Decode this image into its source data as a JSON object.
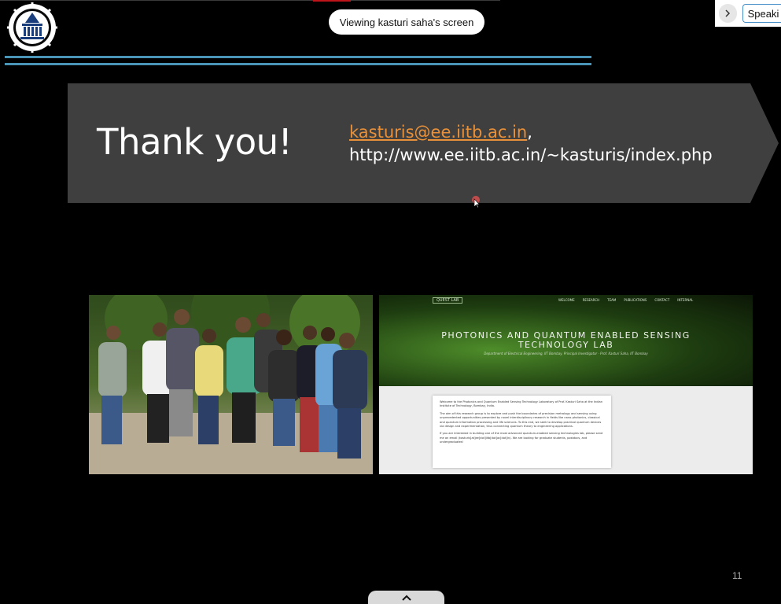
{
  "share_banner": {
    "text": "Viewing kasturi saha's screen"
  },
  "speaker_panel": {
    "label": "Speaki",
    "arrow": "chevron-right-icon"
  },
  "slide": {
    "heading": "Thank you!",
    "email": "kasturis@ee.iitb.ac.in",
    "email_suffix": ",",
    "url": "http://www.ee.iitb.ac.in/~kasturis/index.php",
    "page_number": "11"
  },
  "website_screenshot": {
    "logo": "QUEST LAB",
    "nav": [
      "WELCOME",
      "RESEARCH",
      "TEAM",
      "PUBLICATIONS",
      "CONTACT",
      "INTERNAL"
    ],
    "title_line1": "PHOTONICS AND QUANTUM ENABLED SENSING",
    "title_line2": "TECHNOLOGY LAB",
    "subtitle": "Department of Electrical Engineering, IIT Bombay, Principal Investigator - Prof. Kasturi Saha, IIT Bombay",
    "para1": "Welcome to the Photonics and Quantum Enabled Sensing Technology Laboratory of Prof. Kasturi Saha at the Indian Institute of Technology, Bombay, India.",
    "para2": "The aim of this research group is to explore and push the boundaries of precision metrology and sensing using unprecedented opportunities presented by novel interdisciplinary research in fields like nano-photonics, classical and quantum information processing and life sciences. To this end, we seek to develop practical quantum devices via design and experimentation, thus connecting quantum theory to engineering applications.",
    "para3": "If you are interested in building one of the most advanced quantum-enabled sensing technologies lab, please send me an email (kasturis[at]ee[dot]iitb[dot]ac[dot]in). We are looking for graduate students, postdocs, and undergraduates!"
  },
  "colors": {
    "accent_rule": "#4a94b8",
    "link": "#e8913a",
    "banner": "#3f3f3f"
  }
}
